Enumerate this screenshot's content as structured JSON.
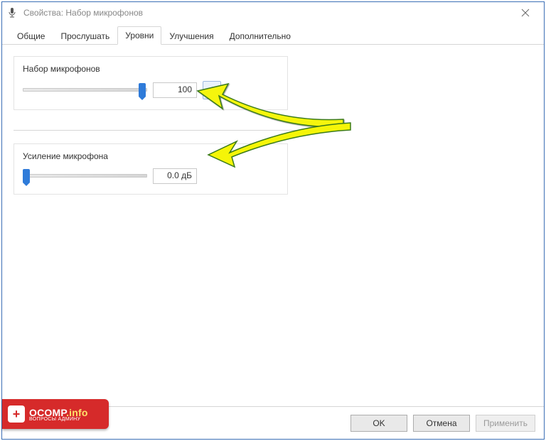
{
  "window": {
    "title": "Свойства: Набор микрофонов"
  },
  "tabs": [
    {
      "label": "Общие"
    },
    {
      "label": "Прослушать"
    },
    {
      "label": "Уровни",
      "active": true
    },
    {
      "label": "Улучшения"
    },
    {
      "label": "Дополнительно"
    }
  ],
  "group1": {
    "label": "Набор микрофонов",
    "value": "100",
    "slider_percent": 100
  },
  "group2": {
    "label": "Усиление микрофона",
    "value": "0.0 дБ",
    "slider_percent": 0
  },
  "footer": {
    "ok": "OK",
    "cancel": "Отмена",
    "apply": "Применить"
  },
  "logo": {
    "main": "OCOMP",
    "suffix": ".info",
    "sub": "ВОПРОСЫ АДМИНУ"
  }
}
